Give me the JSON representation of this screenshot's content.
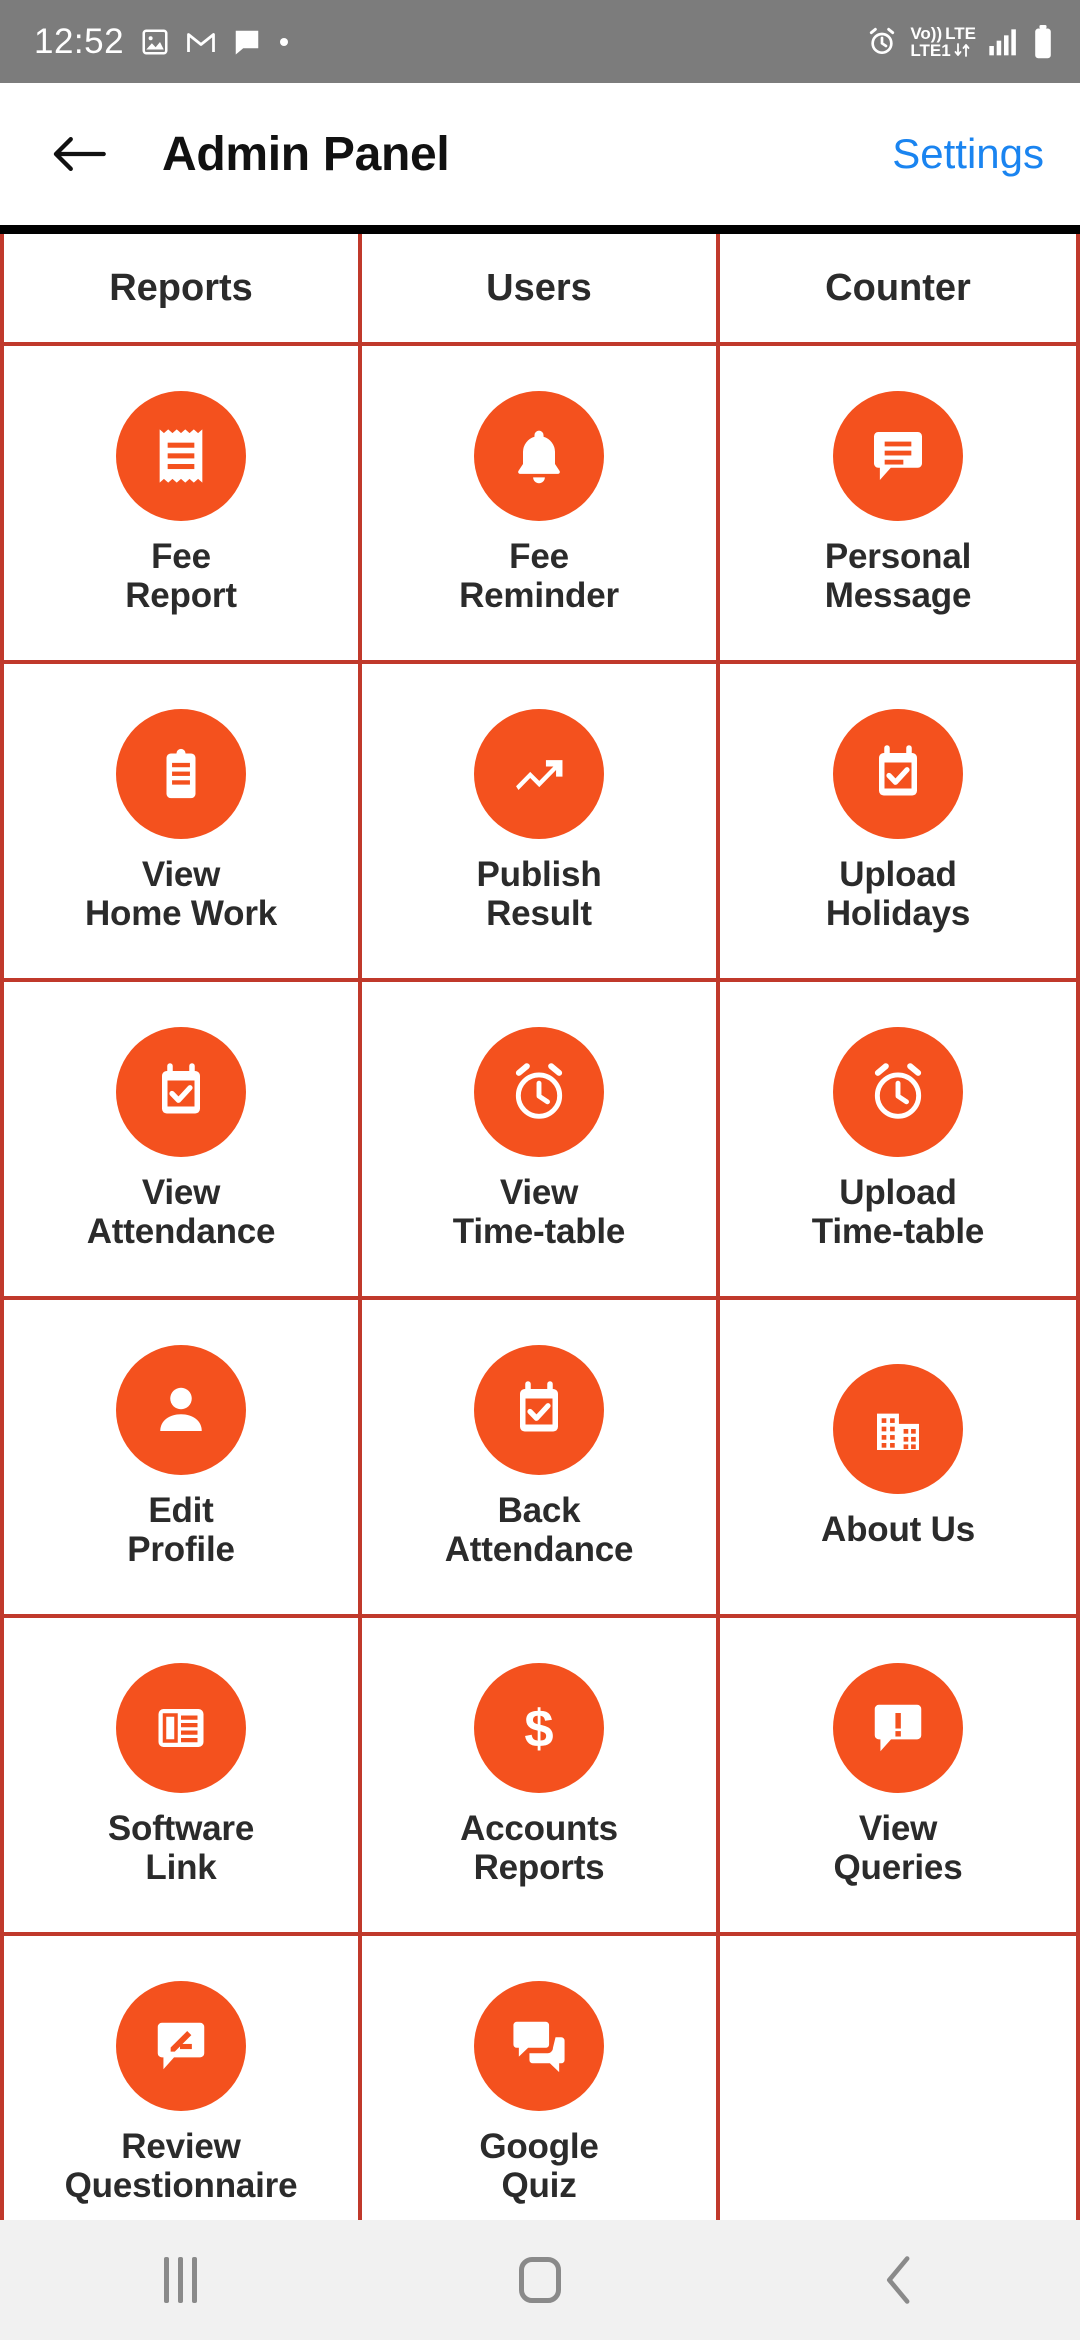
{
  "status_bar": {
    "time": "12:52",
    "left_icons": [
      "gallery-icon",
      "gmail-icon",
      "message-icon",
      "dot-icon"
    ],
    "network_top": "LTE",
    "network_bottom": "LTE1",
    "volte_label": "Vo))",
    "right_icons": [
      "alarm-icon",
      "volte-icon",
      "signal-icon",
      "battery-icon"
    ],
    "background": "#7c7c7c"
  },
  "app_bar": {
    "back_icon": "arrow-left-icon",
    "title": "Admin Panel",
    "settings_label": "Settings",
    "settings_color": "#1a84f0"
  },
  "theme": {
    "accent": "#f4511e",
    "grid_line": "#c0392b",
    "top_border": "#000000",
    "text": "#2b2b2b"
  },
  "grid": {
    "headers": [
      "Reports",
      "Users",
      "Counter"
    ],
    "rows": [
      [
        {
          "label": "Fee\nReport",
          "icon": "receipt-icon"
        },
        {
          "label": "Fee\nReminder",
          "icon": "bell-icon"
        },
        {
          "label": "Personal\nMessage",
          "icon": "message-lines-icon"
        }
      ],
      [
        {
          "label": "View\nHome Work",
          "icon": "clipboard-icon"
        },
        {
          "label": "Publish\nResult",
          "icon": "trending-up-icon"
        },
        {
          "label": "Upload\nHolidays",
          "icon": "calendar-check-icon"
        }
      ],
      [
        {
          "label": "View\nAttendance",
          "icon": "calendar-check-icon"
        },
        {
          "label": "View\nTime-table",
          "icon": "alarm-clock-icon"
        },
        {
          "label": "Upload\nTime-table",
          "icon": "alarm-clock-icon"
        }
      ],
      [
        {
          "label": "Edit\nProfile",
          "icon": "person-icon"
        },
        {
          "label": "Back\nAttendance",
          "icon": "calendar-check-icon"
        },
        {
          "label": "About Us",
          "icon": "building-icon"
        }
      ],
      [
        {
          "label": "Software\nLink",
          "icon": "article-icon"
        },
        {
          "label": "Accounts\nReports",
          "icon": "dollar-icon"
        },
        {
          "label": "View\nQueries",
          "icon": "message-alert-icon"
        }
      ],
      [
        {
          "label": "Review\nQuestionnaire",
          "icon": "rate-review-icon"
        },
        {
          "label": "Google\nQuiz",
          "icon": "forum-icon"
        },
        {
          "label": "",
          "icon": ""
        }
      ]
    ]
  },
  "nav_bar": {
    "recents_label": "recents-icon",
    "home_label": "home-icon",
    "back_label": "back-icon",
    "background": "#f1f1f1"
  }
}
